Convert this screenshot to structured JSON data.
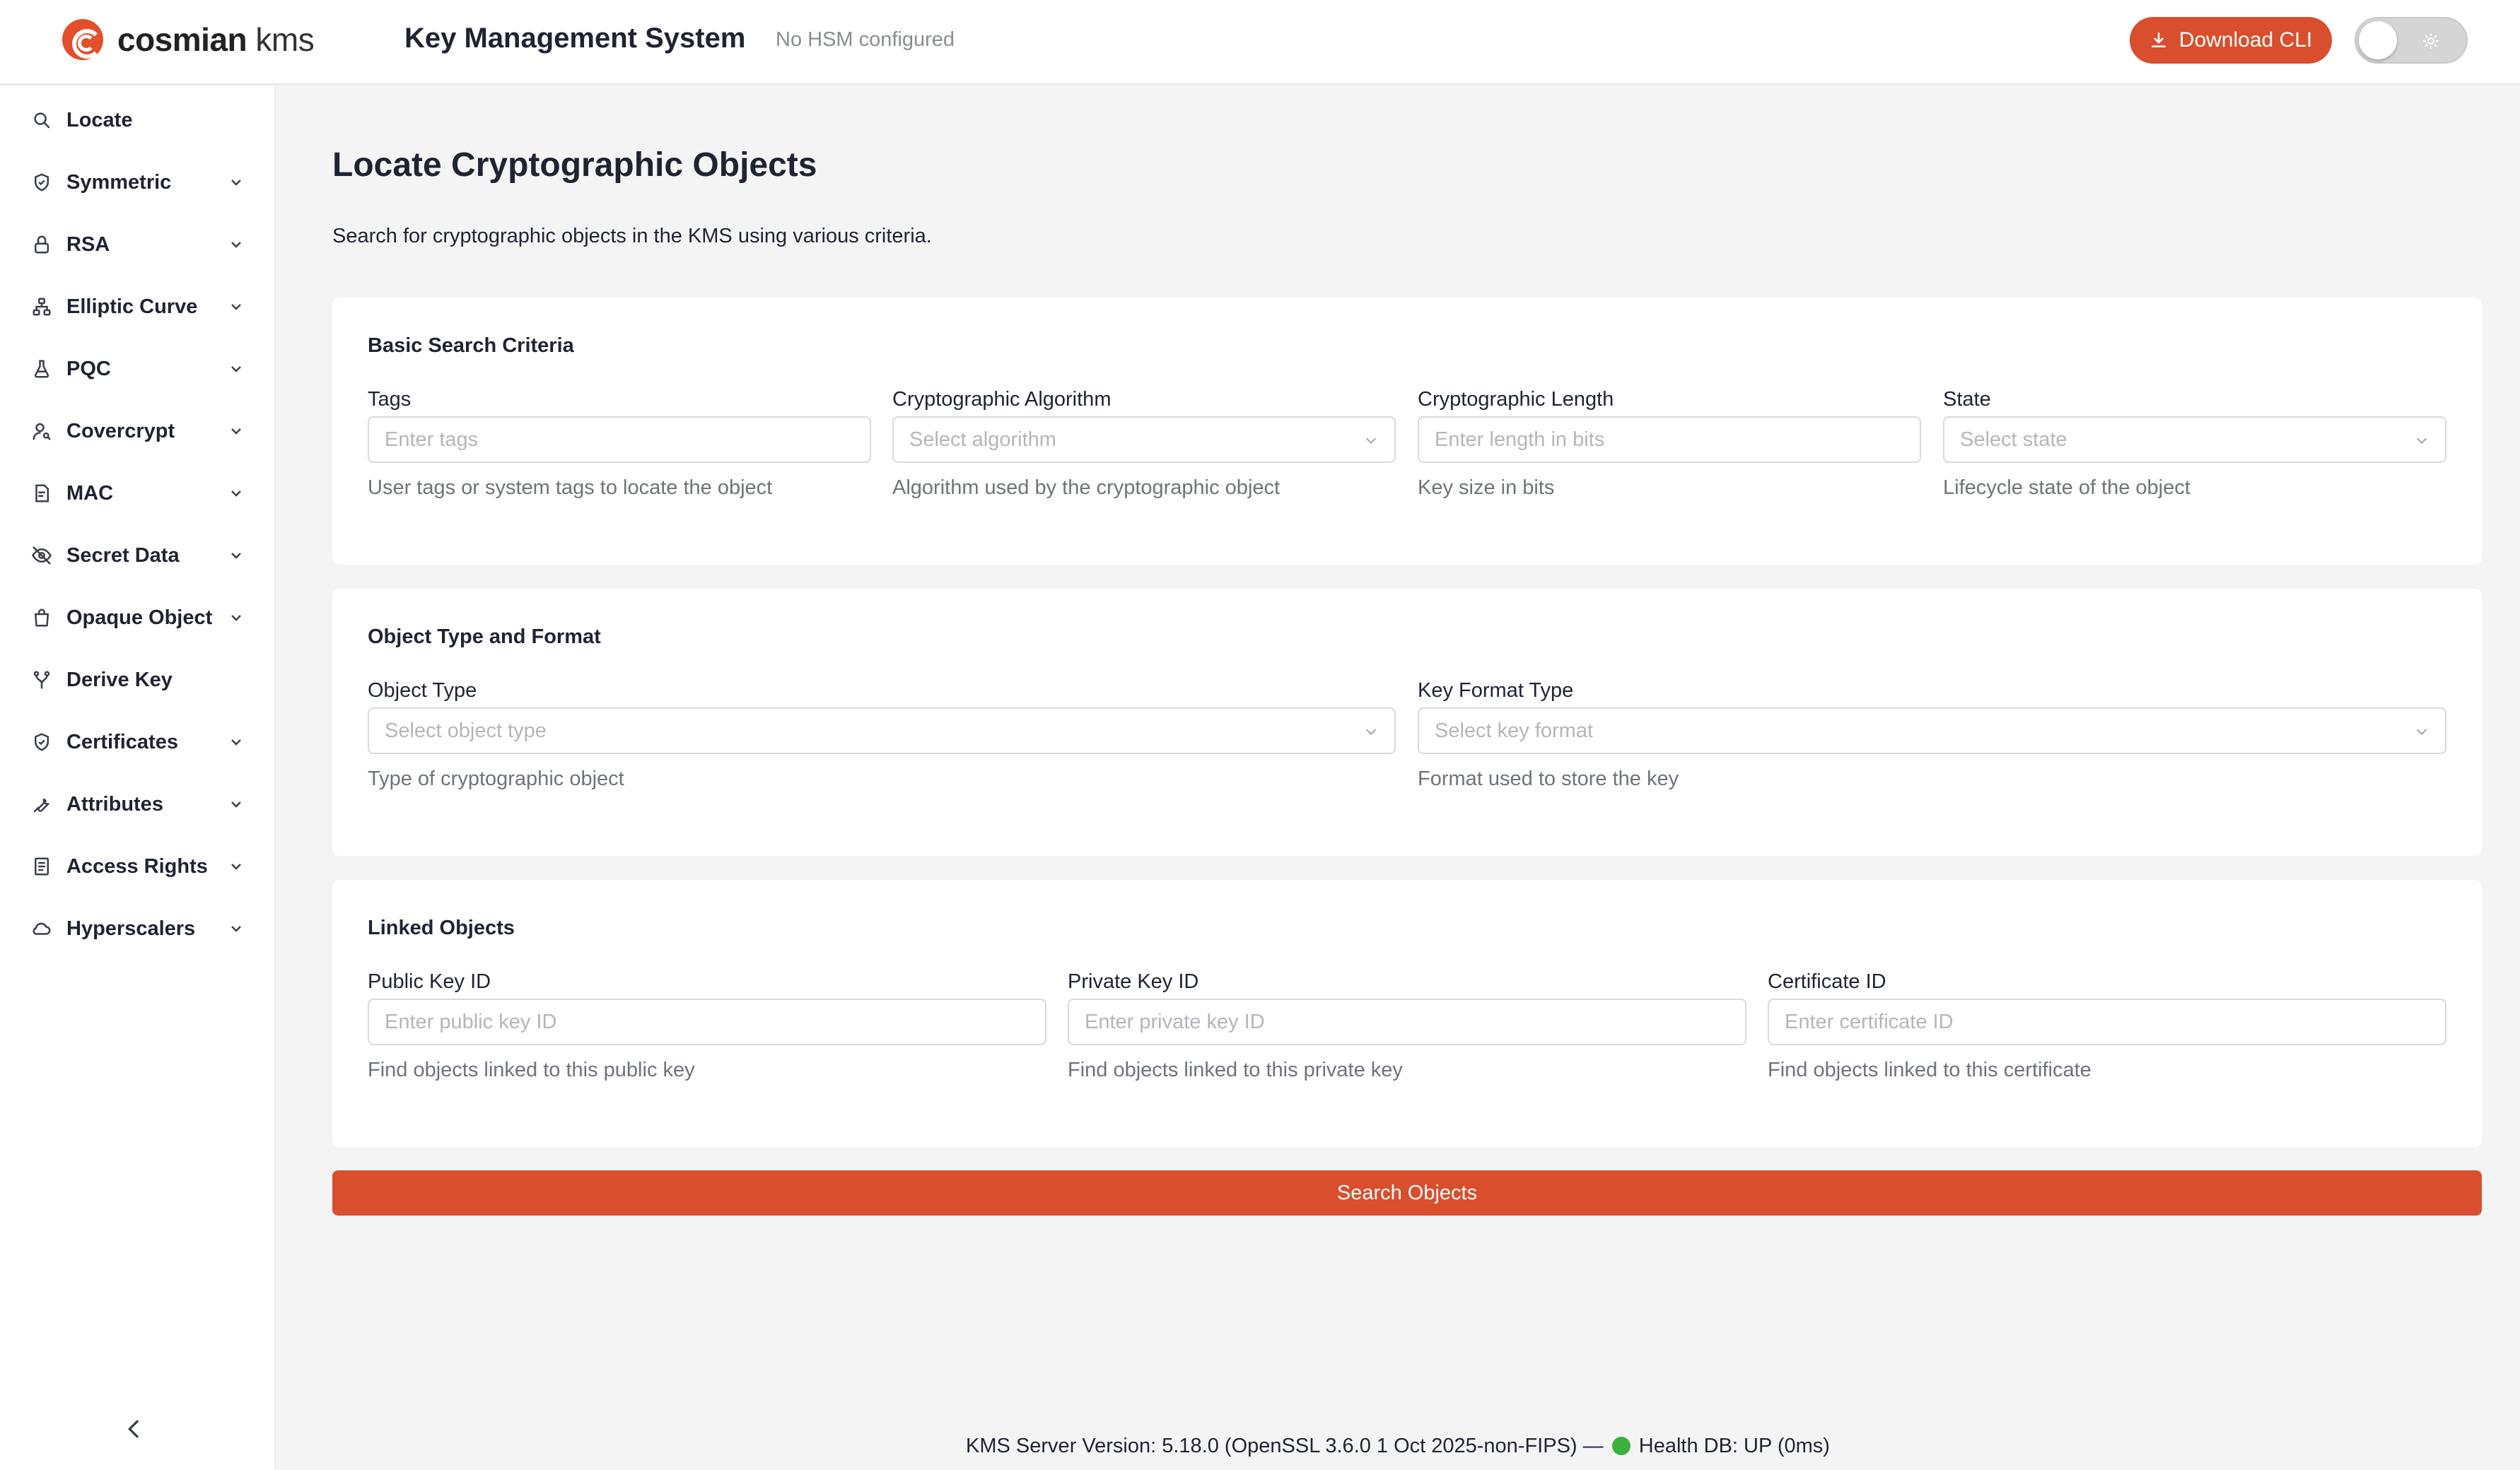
{
  "header": {
    "logo_bold": "cosmian",
    "logo_light": "kms",
    "app_title": "Key Management System",
    "hsm_status": "No HSM configured",
    "download_label": "Download CLI"
  },
  "sidebar": {
    "items": [
      {
        "label": "Locate",
        "icon": "search-icon",
        "expandable": false
      },
      {
        "label": "Symmetric",
        "icon": "shield-icon",
        "expandable": true
      },
      {
        "label": "RSA",
        "icon": "lock-icon",
        "expandable": true
      },
      {
        "label": "Elliptic Curve",
        "icon": "network-icon",
        "expandable": true
      },
      {
        "label": "PQC",
        "icon": "flask-icon",
        "expandable": true
      },
      {
        "label": "Covercrypt",
        "icon": "user-key-icon",
        "expandable": true
      },
      {
        "label": "MAC",
        "icon": "document-icon",
        "expandable": true
      },
      {
        "label": "Secret Data",
        "icon": "eye-off-icon",
        "expandable": true
      },
      {
        "label": "Opaque Object",
        "icon": "bag-icon",
        "expandable": true
      },
      {
        "label": "Derive Key",
        "icon": "branch-icon",
        "expandable": false
      },
      {
        "label": "Certificates",
        "icon": "certificate-icon",
        "expandable": true
      },
      {
        "label": "Attributes",
        "icon": "wrench-icon",
        "expandable": true
      },
      {
        "label": "Access Rights",
        "icon": "list-icon",
        "expandable": true
      },
      {
        "label": "Hyperscalers",
        "icon": "cloud-icon",
        "expandable": true
      }
    ]
  },
  "main": {
    "title": "Locate Cryptographic Objects",
    "description": "Search for cryptographic objects in the KMS using various criteria.",
    "basic": {
      "title": "Basic Search Criteria",
      "tags": {
        "label": "Tags",
        "placeholder": "Enter tags",
        "help": "User tags or system tags to locate the object"
      },
      "algorithm": {
        "label": "Cryptographic Algorithm",
        "placeholder": "Select algorithm",
        "help": "Algorithm used by the cryptographic object"
      },
      "length": {
        "label": "Cryptographic Length",
        "placeholder": "Enter length in bits",
        "help": "Key size in bits"
      },
      "state": {
        "label": "State",
        "placeholder": "Select state",
        "help": "Lifecycle state of the object"
      }
    },
    "type_format": {
      "title": "Object Type and Format",
      "object_type": {
        "label": "Object Type",
        "placeholder": "Select object type",
        "help": "Type of cryptographic object"
      },
      "key_format": {
        "label": "Key Format Type",
        "placeholder": "Select key format",
        "help": "Format used to store the key"
      }
    },
    "linked": {
      "title": "Linked Objects",
      "public_key": {
        "label": "Public Key ID",
        "placeholder": "Enter public key ID",
        "help": "Find objects linked to this public key"
      },
      "private_key": {
        "label": "Private Key ID",
        "placeholder": "Enter private key ID",
        "help": "Find objects linked to this private key"
      },
      "certificate": {
        "label": "Certificate ID",
        "placeholder": "Enter certificate ID",
        "help": "Find objects linked to this certificate"
      }
    },
    "search_label": "Search Objects"
  },
  "footer": {
    "version_text": "KMS Server Version: 5.18.0 (OpenSSL 3.6.0 1 Oct 2025-non-FIPS) —",
    "health_text": "Health DB: UP (0ms)"
  },
  "colors": {
    "accent": "#d94e2d",
    "health": "#39b13a",
    "background": "#f4f4f4"
  }
}
